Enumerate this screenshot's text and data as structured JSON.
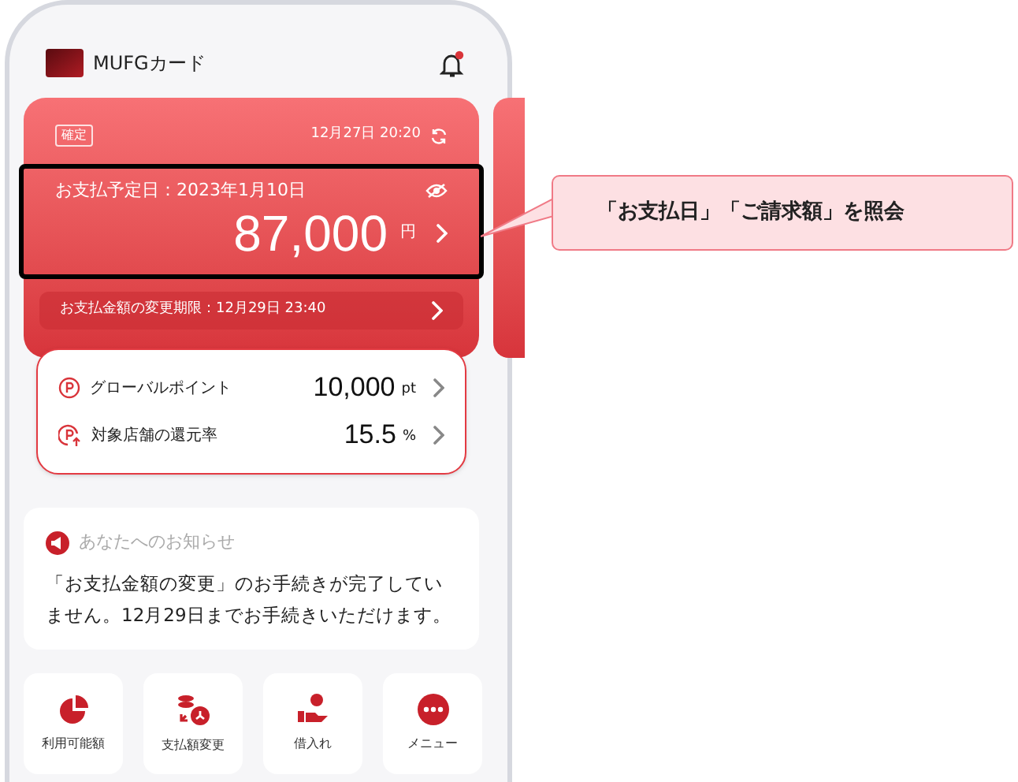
{
  "header": {
    "title": "MUFGカード"
  },
  "payment_card": {
    "status_badge": "確定",
    "updated": "12月27日 20:20",
    "due_label": "お支払予定日：2023年1月10日",
    "amount": "87,000",
    "currency": "円",
    "change_deadline": "お支払金額の変更期限：12月29日 23:40"
  },
  "points": [
    {
      "kind": "points",
      "label": "グローバルポイント",
      "value": "10,000",
      "unit": "pt"
    },
    {
      "kind": "rate",
      "label": "対象店舗の還元率",
      "value": "15.5",
      "unit": "%"
    }
  ],
  "notice": {
    "title": "あなたへのお知らせ",
    "body": "「お支払金額の変更」のお手続きが完了していません。12月29日までお手続きいただけます。"
  },
  "quick_actions": [
    {
      "kind": "pie",
      "label": "利用可能額"
    },
    {
      "kind": "coins",
      "label": "支払額変更"
    },
    {
      "kind": "lend",
      "label": "借入れ"
    },
    {
      "kind": "menu",
      "label": "メニュー"
    }
  ],
  "callout": {
    "text": "「お支払日」「ご請求額」を照会"
  }
}
